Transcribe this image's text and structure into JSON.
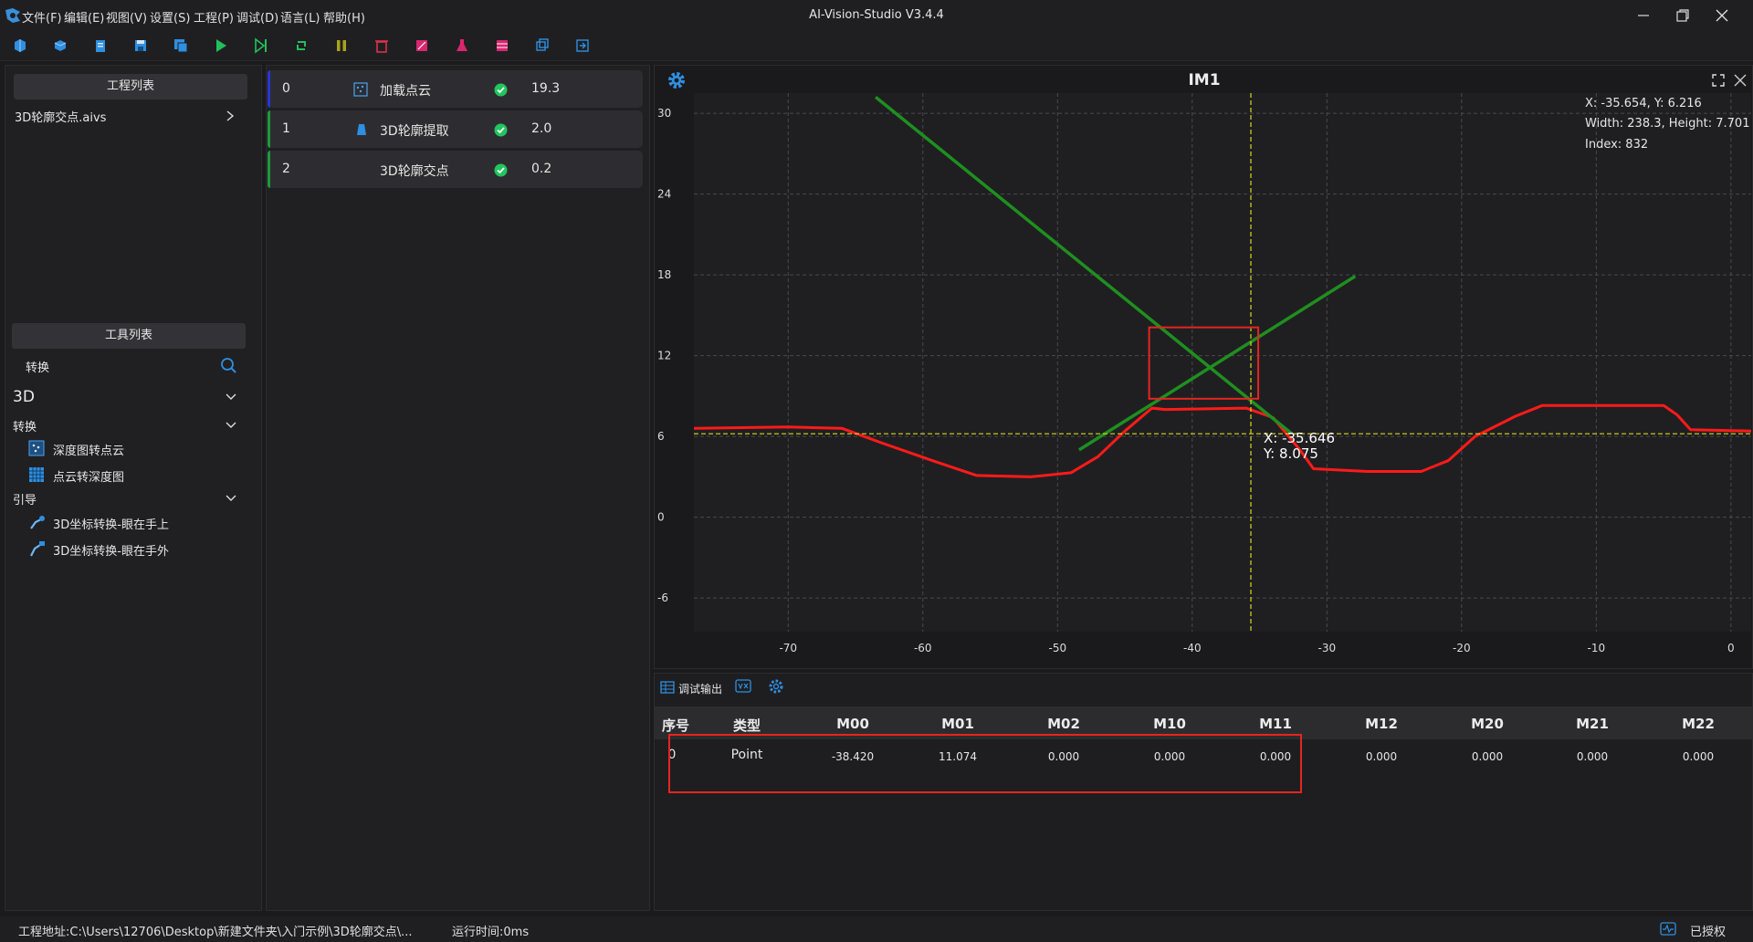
{
  "app": {
    "title": "AI-Vision-Studio V3.4.4"
  },
  "menu": [
    "文件(F)",
    "编辑(E)",
    "视图(V)",
    "设置(S)",
    "工程(P)",
    "调试(D)",
    "语言(L)",
    "帮助(H)"
  ],
  "project_panel": {
    "header": "工程列表",
    "file": "3D轮廓交点.aivs"
  },
  "tool_panel": {
    "header": "工具列表",
    "search_value": "转换",
    "category_3d": "3D",
    "group_convert": "转换",
    "item_depth_to_cloud": "深度图转点云",
    "item_cloud_to_depth": "点云转深度图",
    "group_guide": "引导",
    "item_eye_in_hand": "3D坐标转换-眼在手上",
    "item_eye_to_hand": "3D坐标转换-眼在手外"
  },
  "flow": [
    {
      "index": "0",
      "name": "加载点云",
      "time": "19.3"
    },
    {
      "index": "1",
      "name": "3D轮廓提取",
      "time": "2.0"
    },
    {
      "index": "2",
      "name": "3D轮廓交点",
      "time": "0.2"
    }
  ],
  "viewer": {
    "title": "IM1",
    "info_line1": "X: -35.654, Y: 6.216",
    "info_line2": "Width: 238.3, Height: 7.701",
    "info_line3": "Index: 832",
    "cursor_label_x": "X: -35.646",
    "cursor_label_y": "Y: 8.075"
  },
  "chart_data": {
    "type": "line",
    "xlim": [
      -77,
      1.5
    ],
    "ylim": [
      -8.5,
      31.5
    ],
    "x_ticks": [
      -70,
      -60,
      -50,
      -40,
      -30,
      -20,
      -10,
      0
    ],
    "y_ticks": [
      30,
      24,
      18,
      12,
      6,
      0,
      -6
    ],
    "grid": true,
    "series": [
      {
        "color": "#ff1a1a",
        "points": [
          [
            -77,
            6.6
          ],
          [
            -70,
            6.7
          ],
          [
            -66,
            6.6
          ],
          [
            -63,
            5.5
          ],
          [
            -59,
            4.1
          ],
          [
            -56,
            3.1
          ],
          [
            -52,
            3.0
          ],
          [
            -49,
            3.3
          ],
          [
            -47,
            4.5
          ],
          [
            -45,
            6.4
          ],
          [
            -43,
            8.1
          ],
          [
            -42,
            8.0
          ],
          [
            -36,
            8.1
          ],
          [
            -34,
            7.4
          ],
          [
            -32,
            5.0
          ],
          [
            -31,
            3.6
          ],
          [
            -27,
            3.4
          ],
          [
            -23,
            3.4
          ],
          [
            -21,
            4.2
          ],
          [
            -19,
            6.0
          ],
          [
            -16,
            7.5
          ],
          [
            -14,
            8.3
          ],
          [
            -9,
            8.3
          ],
          [
            -5,
            8.3
          ],
          [
            -4,
            7.6
          ],
          [
            -3,
            6.5
          ],
          [
            1.5,
            6.4
          ]
        ]
      },
      {
        "color": "#1f8f1f",
        "points": [
          [
            -63.5,
            31.2
          ],
          [
            -32.6,
            6.2
          ]
        ]
      },
      {
        "color": "#1f8f1f",
        "points": [
          [
            -48.4,
            5.0
          ],
          [
            -27.9,
            17.9
          ]
        ]
      }
    ],
    "crosshair": {
      "x": -35.646,
      "y": 6.2
    },
    "roi": {
      "x0": -43.2,
      "x1": -35.1,
      "y0": 8.8,
      "y1": 14.1
    }
  },
  "debug": {
    "tab_label": "调试输出",
    "columns": [
      "序号",
      "类型",
      "M00",
      "M01",
      "M02",
      "M10",
      "M11",
      "M12",
      "M20",
      "M21",
      "M22"
    ],
    "rows": [
      [
        "0",
        "Point",
        "-38.420",
        "11.074",
        "0.000",
        "0.000",
        "0.000",
        "0.000",
        "0.000",
        "0.000",
        "0.000"
      ]
    ]
  },
  "status": {
    "path": "工程地址:C:\\Users\\12706\\Desktop\\新建文件夹\\入门示例\\3D轮廓交点\\...",
    "runtime": "运行时间:0ms",
    "license": "已授权"
  },
  "colors": {
    "accent": "#2f8fe0",
    "ok": "#22c55e",
    "annot": "#e5251f"
  }
}
